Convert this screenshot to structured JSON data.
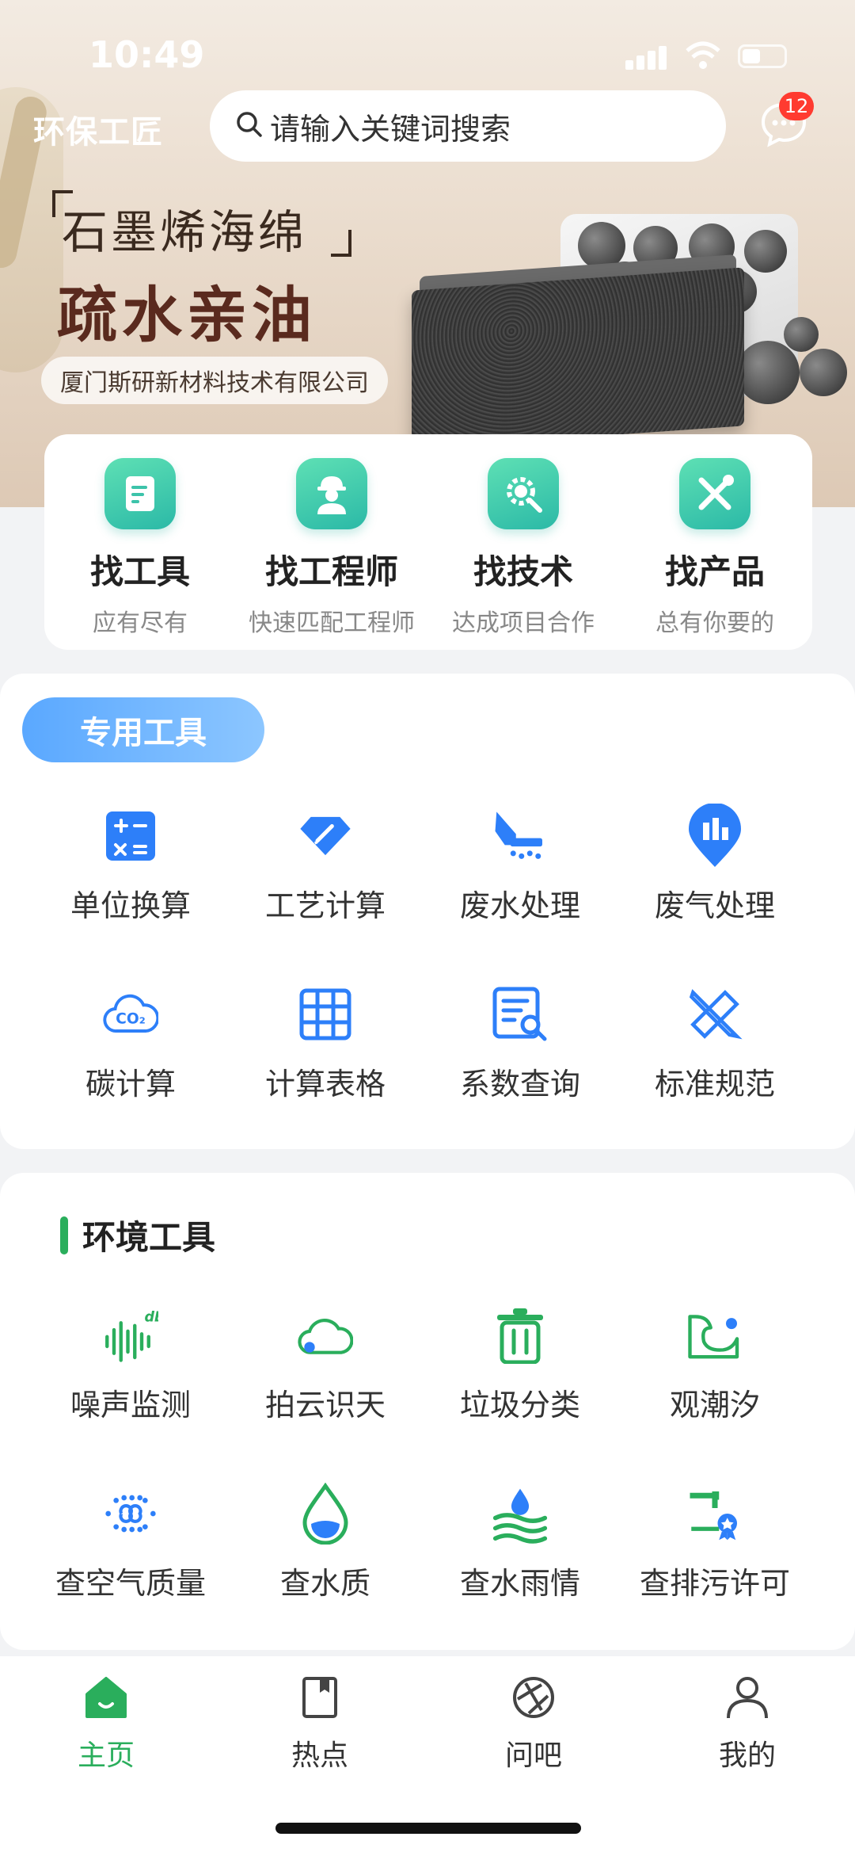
{
  "status_bar": {
    "time": "10:49"
  },
  "header": {
    "brand": "环保工匠",
    "search_placeholder": "请输入关键词搜索",
    "message_badge": "12"
  },
  "banner": {
    "title_line1": "石墨烯海绵",
    "title_line2": "疏水亲油",
    "company": "厦门斯研新材料技术有限公司"
  },
  "quick_entries": [
    {
      "title": "找工具",
      "subtitle": "应有尽有",
      "icon": "document-icon"
    },
    {
      "title": "找工程师",
      "subtitle": "快速匹配工程师",
      "icon": "engineer-icon"
    },
    {
      "title": "找技术",
      "subtitle": "达成项目合作",
      "icon": "gear-search-icon"
    },
    {
      "title": "找产品",
      "subtitle": "总有你要的",
      "icon": "tools-icon"
    }
  ],
  "special_tools": {
    "tag": "专用工具",
    "items": [
      {
        "label": "单位换算",
        "icon": "calculator-icon"
      },
      {
        "label": "工艺计算",
        "icon": "diamond-pencil-icon"
      },
      {
        "label": "废水处理",
        "icon": "wastewater-icon"
      },
      {
        "label": "废气处理",
        "icon": "factory-pin-icon"
      },
      {
        "label": "碳计算",
        "icon": "co2-cloud-icon"
      },
      {
        "label": "计算表格",
        "icon": "table-icon"
      },
      {
        "label": "系数查询",
        "icon": "list-search-icon"
      },
      {
        "label": "标准规范",
        "icon": "ruler-pencil-icon"
      }
    ]
  },
  "env_tools": {
    "title": "环境工具",
    "items": [
      {
        "label": "噪声监测",
        "icon": "sound-wave-icon"
      },
      {
        "label": "拍云识天",
        "icon": "cloud-icon"
      },
      {
        "label": "垃圾分类",
        "icon": "trash-icon"
      },
      {
        "label": "观潮汐",
        "icon": "wave-icon"
      },
      {
        "label": "查空气质量",
        "icon": "air-quality-icon"
      },
      {
        "label": "查水质",
        "icon": "water-drop-icon"
      },
      {
        "label": "查水雨情",
        "icon": "rain-water-icon"
      },
      {
        "label": "查排污许可",
        "icon": "permit-icon"
      }
    ]
  },
  "bottom_nav": [
    {
      "label": "主页",
      "icon": "home-icon",
      "active": true
    },
    {
      "label": "热点",
      "icon": "bookmark-icon",
      "active": false
    },
    {
      "label": "问吧",
      "icon": "aperture-icon",
      "active": false
    },
    {
      "label": "我的",
      "icon": "user-icon",
      "active": false
    }
  ],
  "colors": {
    "accent_green": "#2aae5c",
    "accent_blue": "#2d7ff9",
    "badge_red": "#ff3b30"
  }
}
